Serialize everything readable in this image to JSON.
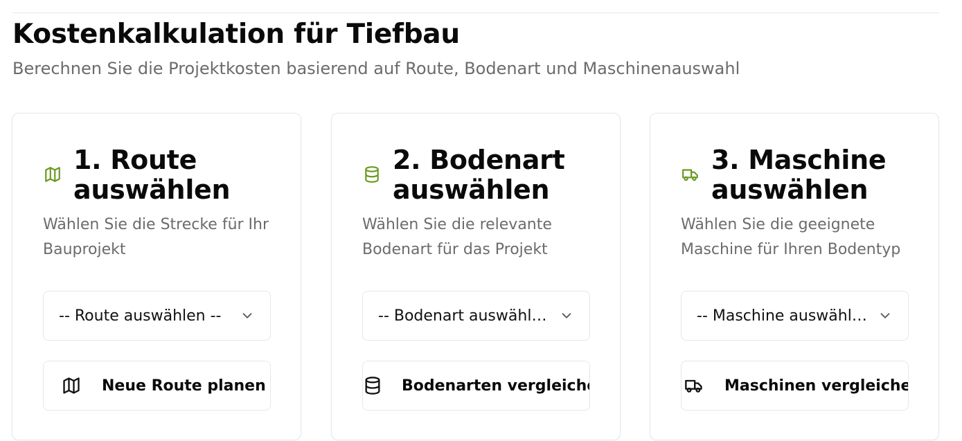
{
  "header": {
    "title": "Kostenkalkulation für Tiefbau",
    "subtitle": "Berechnen Sie die Projektkosten basierend auf Route, Bodenart und Maschinenauswahl"
  },
  "colors": {
    "accent": "#6a9a1f",
    "border": "#e5e7eb",
    "muted_text": "#6b6b6b"
  },
  "cards": [
    {
      "icon": "map-icon",
      "title": "1. Route auswählen",
      "description": "Wählen Sie die Strecke für Ihr Bauprojekt",
      "select_value": "-- Route auswählen --",
      "action_icon": "map-icon",
      "action_label": "Neue Route planen"
    },
    {
      "icon": "database-icon",
      "title": "2. Bodenart auswählen",
      "description": "Wählen Sie die relevante Bodenart für das Projekt",
      "select_value": "-- Bodenart auswählen --",
      "action_icon": "database-icon",
      "action_label": "Bodenarten vergleichen"
    },
    {
      "icon": "truck-icon",
      "title": "3. Maschine auswählen",
      "description": "Wählen Sie die geeignete Maschine für Ihren Bodentyp",
      "select_value": "-- Maschine auswählen --",
      "action_icon": "truck-icon",
      "action_label": "Maschinen vergleichen"
    }
  ]
}
